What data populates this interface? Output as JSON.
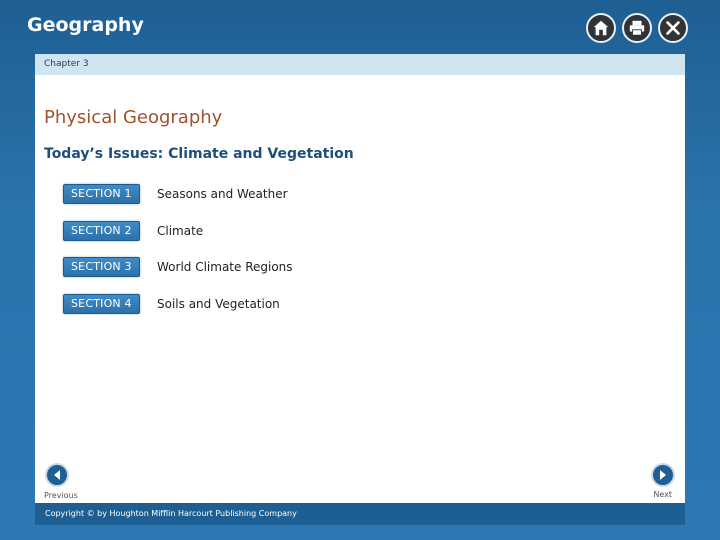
{
  "app": {
    "title": "Geography"
  },
  "toolbar": {
    "icons": [
      "home-icon",
      "print-icon",
      "close-icon"
    ]
  },
  "chapter": {
    "label": "Chapter 3"
  },
  "main": {
    "title": "Physical Geography",
    "subtitle": "Today’s Issues: Climate and Vegetation",
    "sections": [
      {
        "button": "SECTION 1",
        "label": "Seasons and Weather"
      },
      {
        "button": "SECTION 2",
        "label": "Climate"
      },
      {
        "button": "SECTION 3",
        "label": "World Climate Regions"
      },
      {
        "button": "SECTION 4",
        "label": "Soils and Vegetation"
      }
    ]
  },
  "nav": {
    "previous": "Previous",
    "next": "Next"
  },
  "footer": {
    "copyright": "Copyright © by Houghton Mifflin Harcourt Publishing Company"
  },
  "colors": {
    "accent_blue": "#2a74ad",
    "title_brown": "#a0522d",
    "subtitle_blue": "#1d4f7c",
    "chapter_bar": "#cfe6f1"
  }
}
